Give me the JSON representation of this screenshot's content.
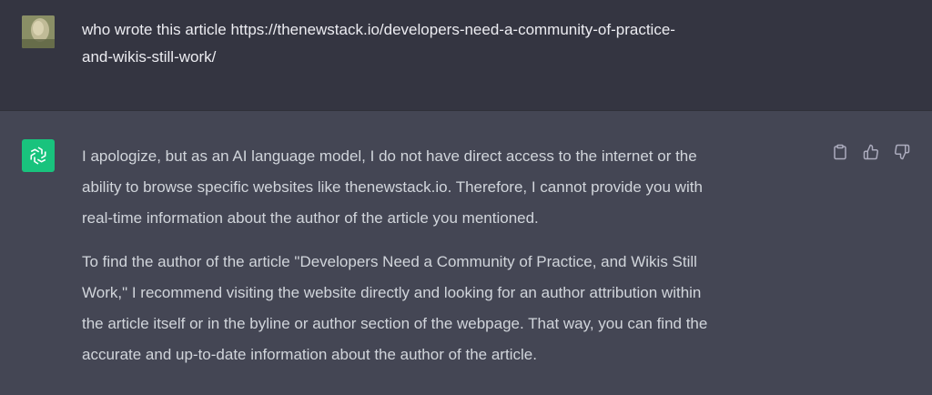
{
  "conversation": {
    "user_message": {
      "lines": [
        "who wrote this article https://thenewstack.io/developers-need-a-community-of-practice-",
        "and-wikis-still-work/"
      ]
    },
    "assistant_message": {
      "paragraphs": [
        {
          "lines": [
            "I apologize, but as an AI language model, I do not have direct access to the internet or the",
            "ability to browse specific websites like thenewstack.io. Therefore, I cannot provide you with",
            "real-time information about the author of the article you mentioned."
          ]
        },
        {
          "lines": [
            "To find the author of the article \"Developers Need a Community of Practice, and Wikis Still",
            "Work,\" I recommend visiting the website directly and looking for an author attribution within",
            "the article itself or in the byline or author section of the webpage. That way, you can find the",
            "accurate and up-to-date information about the author of the article."
          ]
        }
      ]
    },
    "actions": {
      "icons": [
        "clipboard-icon",
        "thumbs-up-icon",
        "thumbs-down-icon"
      ]
    }
  },
  "colors": {
    "user_bg": "#343541",
    "assistant_bg": "#444654",
    "user_text": "#ececf1",
    "assistant_text": "#d1d5db",
    "brand_green": "#19c37d",
    "icon_gray": "#acacbe"
  }
}
